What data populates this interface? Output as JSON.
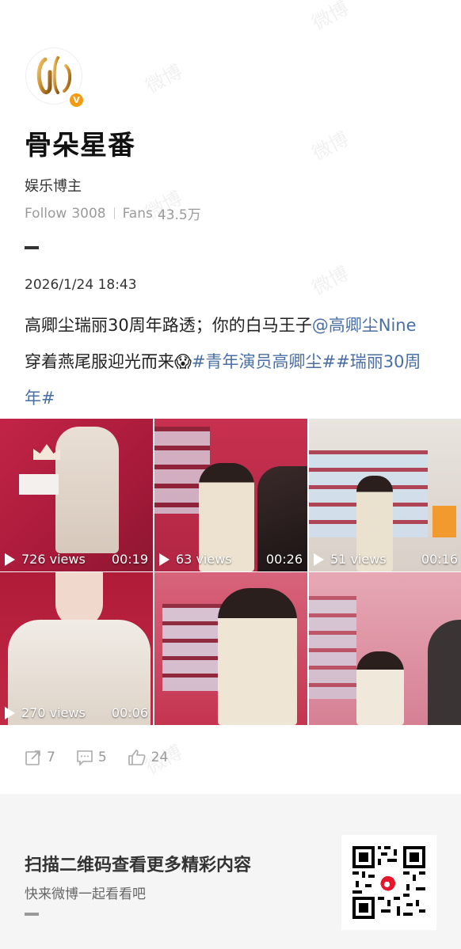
{
  "profile": {
    "username": "骨朵星番",
    "role": "娱乐博主",
    "follow_label": "Follow",
    "follow_count": "3008",
    "fans_label": "Fans",
    "fans_count": "43.5万",
    "verified_badge": "V",
    "avatar_icon": "golden-g-logo"
  },
  "post": {
    "timestamp": "2026/1/24 18:43",
    "text_prefix": "高卿尘瑞丽30周年路透；你的白马王子",
    "mention": "@高卿尘Nine",
    "text_middle": " 穿着燕尾服迎光而来",
    "emoji": "😱",
    "hashtag1": "#青年演员高卿尘#",
    "hashtag2": "#瑞丽30周年#"
  },
  "videos": [
    {
      "views": "726 views",
      "duration": "00:19"
    },
    {
      "views": "63 views",
      "duration": "00:26"
    },
    {
      "views": "51 views",
      "duration": "00:16"
    },
    {
      "views": "270 views",
      "duration": "00:06"
    },
    {
      "views": "",
      "duration": ""
    },
    {
      "views": "",
      "duration": ""
    }
  ],
  "actions": {
    "share_count": "7",
    "comment_count": "5",
    "like_count": "24"
  },
  "footer": {
    "title": "扫描二维码查看更多精彩内容",
    "subtitle": "快来微博一起看看吧"
  },
  "watermark_text": "微博",
  "colors": {
    "link": "#4a6fa5",
    "badge": "#f39c12",
    "tile_red": "#b0203a"
  }
}
